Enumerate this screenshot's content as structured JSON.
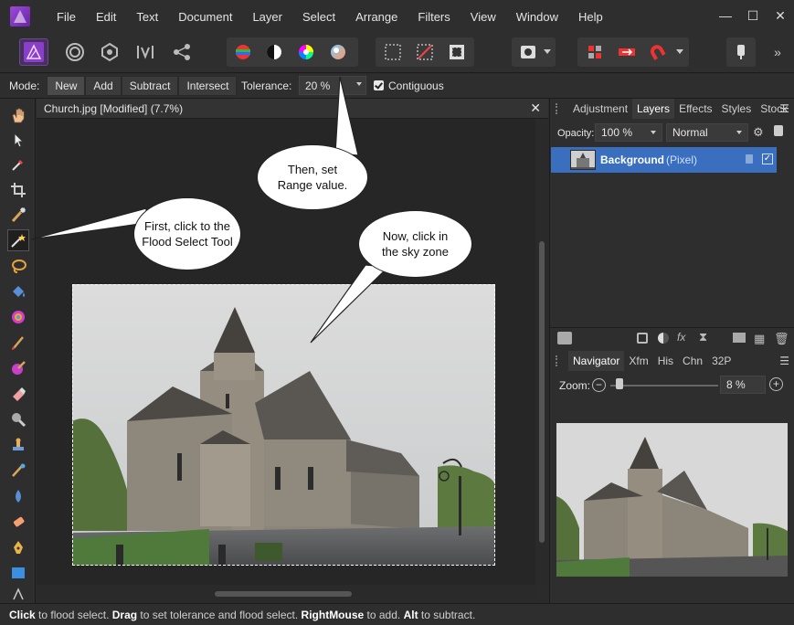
{
  "menu": {
    "items": [
      "File",
      "Edit",
      "Text",
      "Document",
      "Layer",
      "Select",
      "Arrange",
      "Filters",
      "View",
      "Window",
      "Help"
    ]
  },
  "window_controls": {
    "minimize": "—",
    "maximize": "☐",
    "close": "✕"
  },
  "context_toolbar": {
    "mode_label": "Mode:",
    "modes": [
      "New",
      "Add",
      "Subtract",
      "Intersect"
    ],
    "active_mode": "New",
    "tolerance_label": "Tolerance:",
    "tolerance_value": "20 %",
    "contiguous_label": "Contiguous",
    "contiguous_checked": true
  },
  "document": {
    "title": "Church.jpg [Modified] (7.7%)",
    "close": "✕"
  },
  "callouts": {
    "first": "First, click to the Flood Select Tool",
    "second": "Then, set Range value.",
    "third": "Now, click in the sky zone"
  },
  "panels": {
    "top_tabs": [
      "Adjustment",
      "Layers",
      "Effects",
      "Styles",
      "Stock"
    ],
    "top_active": "Layers",
    "opacity_label": "Opacity:",
    "opacity_value": "100 %",
    "blend_mode": "Normal",
    "layer": {
      "name": "Background",
      "type": "(Pixel)"
    },
    "bottom_tabs": [
      "Navigator",
      "Xfm",
      "His",
      "Chn",
      "32P"
    ],
    "bottom_active": "Navigator",
    "zoom_label": "Zoom:",
    "zoom_value": "8 %"
  },
  "status": {
    "click_key": "Click",
    "click_text": " to flood select. ",
    "drag_key": "Drag",
    "drag_text": " to set tolerance and flood select. ",
    "right_key": "RightMouse",
    "right_text": " to add. ",
    "alt_key": "Alt",
    "alt_text": " to subtract."
  },
  "colors": {
    "accent": "#3a6fbf",
    "brand": "#8a3fc8"
  }
}
